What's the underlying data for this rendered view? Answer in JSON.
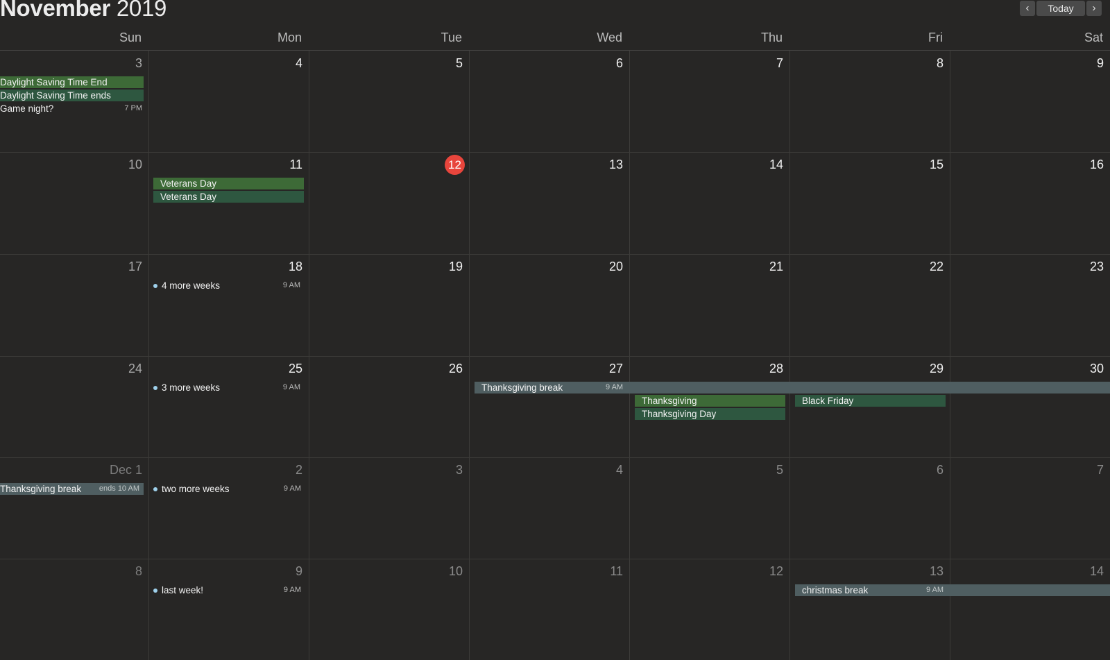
{
  "header": {
    "month": "November",
    "year": "2019",
    "prev_icon": "chevron-left-icon",
    "next_icon": "chevron-right-icon",
    "prev_glyph": "‹",
    "next_glyph": "›",
    "today_label": "Today"
  },
  "weekdays": [
    "Sun",
    "Mon",
    "Tue",
    "Wed",
    "Thu",
    "Fri",
    "Sat"
  ],
  "colors": {
    "background": "#272625",
    "today_marker": "#e8453c",
    "holiday_primary": "#3d6a37",
    "holiday_secondary": "#2e5740",
    "break_event": "#4f5e61",
    "reminder_dot": "#9fd1ec"
  },
  "weeks": [
    {
      "dates": [
        "3",
        "4",
        "5",
        "6",
        "7",
        "8",
        "9"
      ]
    },
    {
      "dates": [
        "10",
        "11",
        "12",
        "13",
        "14",
        "15",
        "16"
      ]
    },
    {
      "dates": [
        "17",
        "18",
        "19",
        "20",
        "21",
        "22",
        "23"
      ]
    },
    {
      "dates": [
        "24",
        "25",
        "26",
        "27",
        "28",
        "29",
        "30"
      ]
    },
    {
      "dates": [
        "Dec 1",
        "2",
        "3",
        "4",
        "5",
        "6",
        "7"
      ]
    },
    {
      "dates": [
        "8",
        "9",
        "10",
        "11",
        "12",
        "13",
        "14"
      ]
    }
  ],
  "today_date": "12",
  "events": {
    "dst_end": {
      "title": "Daylight Saving Time End"
    },
    "dst_ends": {
      "title": "Daylight Saving Time ends"
    },
    "game_night": {
      "title": "Game night?",
      "time": "7 PM"
    },
    "veterans_1": {
      "title": "Veterans Day"
    },
    "veterans_2": {
      "title": "Veterans Day"
    },
    "four_weeks": {
      "title": "4 more weeks",
      "time": "9 AM"
    },
    "three_weeks": {
      "title": "3 more weeks",
      "time": "9 AM"
    },
    "thanksgiving_break": {
      "title": "Thanksgiving break",
      "time": "9 AM"
    },
    "thanksgiving": {
      "title": "Thanksgiving"
    },
    "thanksgiving_day": {
      "title": "Thanksgiving Day"
    },
    "black_friday": {
      "title": "Black Friday"
    },
    "thanksgiving_break_end": {
      "title": "Thanksgiving break",
      "time": "ends 10 AM"
    },
    "two_weeks": {
      "title": "two more weeks",
      "time": "9 AM"
    },
    "last_week": {
      "title": "last week!",
      "time": "9 AM"
    },
    "christmas_break": {
      "title": "christmas break",
      "time": "9 AM"
    }
  }
}
